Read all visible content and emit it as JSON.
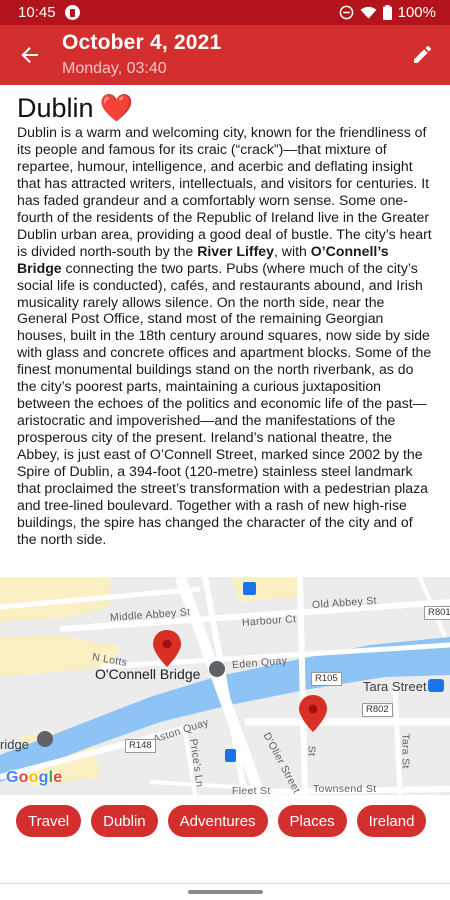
{
  "status_bar": {
    "time": "10:45",
    "battery": "100%",
    "icons": [
      "app-notification-icon",
      "do-not-disturb-icon",
      "wifi-icon",
      "battery-icon"
    ]
  },
  "app_bar": {
    "title": "October 4, 2021",
    "subtitle": "Monday, 03:40",
    "back_icon": "arrow-back-icon",
    "edit_icon": "pencil-icon",
    "color": "#d32f2f",
    "status_color": "#b3141c"
  },
  "entry": {
    "title": "Dublin",
    "title_emoji": "❤️",
    "body_parts": [
      "Dublin is a warm and welcoming city, known for the friendliness of its people and famous for its craic (“crack”)—that mixture of repartee, humour, intelligence, and acerbic and deflating insight that has attracted writers, intellectuals, and visitors for centuries. It has faded grandeur and a comfortably worn sense. Some one-fourth of the residents of the Republic of Ireland live in the Greater Dublin urban area, providing a good deal of bustle. The city’s heart is divided north-south by the ",
      "River Liffey",
      ", with ",
      "O’Connell’s Bridge",
      " connecting the two parts. Pubs (where much of the city’s social life is conducted), cafés, and restaurants abound, and Irish musicality rarely allows silence. On the north side, near the General Post Office, stand most of the remaining Georgian houses, built in the 18th century around squares, now side by side with glass and concrete offices and apartment blocks. Some of the finest monumental buildings stand on the north riverbank, as do the city’s poorest parts, maintaining a curious juxtaposition between the echoes of the politics and economic life of the past—aristocratic and impoverished—and the manifestations of the prosperous city of the present. Ireland’s national theatre, the Abbey, is just east of O’Connell Street, marked since 2002 by the Spire of Dublin, a 394-foot (120-metre) stainless steel landmark that proclaimed the street’s transformation with a pedestrian plaza and tree-lined boulevard. Together with a rash of new high-rise buildings, the spire has changed the character of the city and of the north side."
    ]
  },
  "map": {
    "labels": {
      "middle_abbey": "Middle Abbey St",
      "harbour": "Harbour Ct",
      "old_abbey": "Old Abbey St",
      "n_lotts": "N Lotts",
      "eden_quay": "Eden Quay",
      "oconnell_bridge": "O'Connell Bridge",
      "tara_street": "Tara Street",
      "bridge": "ridge",
      "aston_quay": "Aston Quay",
      "prices_ln": "Price's Ln",
      "dolier": "D'Olier Street",
      "fleet": "Fleet St",
      "townsend": "Townsend St",
      "st": "St",
      "tara_side": "Tara St"
    },
    "badges": {
      "r801": "R801",
      "r105": "R105",
      "r802": "R802",
      "r148": "R148"
    },
    "logo": {
      "g": "G",
      "o1": "o",
      "o2": "o",
      "g2": "g",
      "l": "l",
      "e": "e"
    },
    "markers": [
      "map-pin-icon",
      "map-pin-icon"
    ],
    "colors": {
      "land": "#ececec",
      "water": "#8ec3f5",
      "road": "#ffffff",
      "highlight_block": "#fbefc4",
      "marker": "#d93025"
    }
  },
  "tags": [
    "Travel",
    "Dublin",
    "Adventures",
    "Places",
    "Ireland"
  ]
}
